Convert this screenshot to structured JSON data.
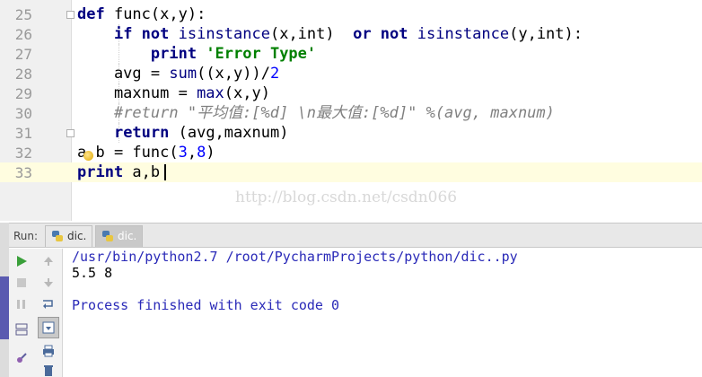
{
  "editor": {
    "lines": [
      {
        "num": "25",
        "tokens": [
          [
            "kw",
            "def "
          ],
          [
            "plain",
            "func(x,y):"
          ]
        ]
      },
      {
        "num": "26",
        "tokens": [
          [
            "plain",
            "    "
          ],
          [
            "kw",
            "if not "
          ],
          [
            "bi",
            "isinstance"
          ],
          [
            "plain",
            "(x,int)  "
          ],
          [
            "kw",
            "or not "
          ],
          [
            "bi",
            "isinstance"
          ],
          [
            "plain",
            "(y,int):"
          ]
        ]
      },
      {
        "num": "27",
        "tokens": [
          [
            "plain",
            "        "
          ],
          [
            "kw",
            "print "
          ],
          [
            "str",
            "'Error Type'"
          ]
        ]
      },
      {
        "num": "28",
        "tokens": [
          [
            "plain",
            "    avg = "
          ],
          [
            "bi",
            "sum"
          ],
          [
            "plain",
            "((x,y))/"
          ],
          [
            "num",
            "2"
          ]
        ]
      },
      {
        "num": "29",
        "tokens": [
          [
            "plain",
            "    maxnum = "
          ],
          [
            "bi",
            "max"
          ],
          [
            "plain",
            "(x,y)"
          ]
        ]
      },
      {
        "num": "30",
        "tokens": [
          [
            "plain",
            "    "
          ],
          [
            "cmt",
            "#return \"平均值:[%d] \\n最大值:[%d]\" %(avg, maxnum)"
          ]
        ]
      },
      {
        "num": "31",
        "tokens": [
          [
            "plain",
            "    "
          ],
          [
            "kw",
            "return "
          ],
          [
            "plain",
            "(avg,maxnum)"
          ]
        ]
      },
      {
        "num": "32",
        "tokens": [
          [
            "plain",
            "a,b = func("
          ],
          [
            "num",
            "3"
          ],
          [
            "plain",
            ","
          ],
          [
            "num",
            "8"
          ],
          [
            "plain",
            ")"
          ]
        ]
      },
      {
        "num": "33",
        "tokens": [
          [
            "kw",
            "print "
          ],
          [
            "plain",
            "a,b"
          ]
        ]
      }
    ],
    "watermark": "http://blog.csdn.net/csdn066"
  },
  "run_panel": {
    "label": "Run:",
    "tabs": [
      {
        "label": "dic.",
        "active": false
      },
      {
        "label": "dic.",
        "active": true
      }
    ],
    "console": {
      "command": "/usr/bin/python2.7 /root/PycharmProjects/python/dic..py",
      "output": "5.5 8",
      "exit": "Process finished with exit code 0"
    }
  },
  "icons": {
    "run": "run-icon",
    "stop": "stop-icon",
    "pause": "pause-icon",
    "up": "scroll-up-icon",
    "down": "scroll-down-icon",
    "wrap": "soft-wrap-icon",
    "scroll_end": "scroll-to-end-icon",
    "print": "print-icon",
    "clear": "clear-icon"
  },
  "colors": {
    "keyword": "#000080",
    "string": "#008000",
    "number": "#0000ff",
    "comment": "#808080",
    "console_link": "#2a2ab8"
  }
}
